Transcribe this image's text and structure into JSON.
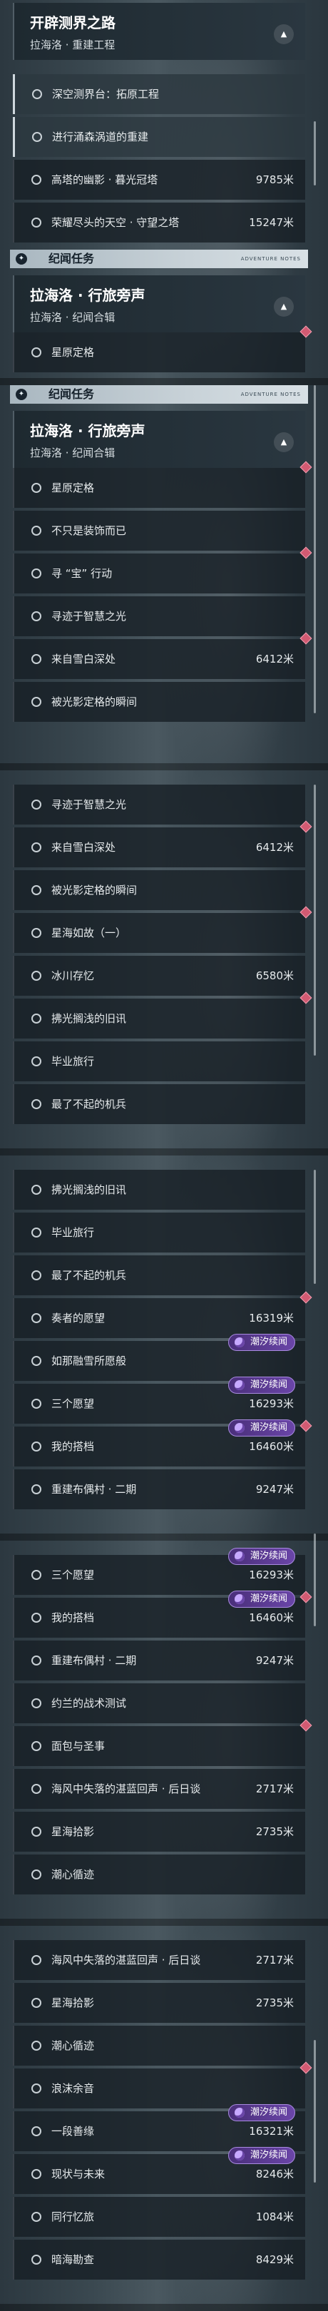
{
  "badge_label": "潮汐续闻",
  "sections": [
    {
      "items": [
        {
          "kind": "header",
          "title": "开辟测界之路",
          "subtitle": "拉海洛 · 重建工程",
          "chevron": "▲"
        },
        {
          "kind": "row",
          "name": "深空测界台：拓原工程",
          "hl": true
        },
        {
          "kind": "row",
          "name": "进行涌森涡道的重建",
          "hl": true
        },
        {
          "kind": "row",
          "name": "高塔的幽影 · 暮光冠塔",
          "dist": "9785米"
        },
        {
          "kind": "row",
          "name": "荣耀尽头的天空 · 守望之塔",
          "dist": "15247米"
        },
        {
          "kind": "cat",
          "title": "纪闻任务",
          "small": "ADVENTURE NOTES",
          "icon": "✦"
        },
        {
          "kind": "header",
          "title": "拉海洛 · 行旅旁声",
          "subtitle": "拉海洛 · 纪闻合辑",
          "chevron": "▲"
        },
        {
          "kind": "row",
          "name": "星原定格",
          "dia": true
        }
      ]
    },
    {
      "items": [
        {
          "kind": "cat",
          "title": "纪闻任务",
          "small": "ADVENTURE NOTES",
          "icon": "✦"
        },
        {
          "kind": "header",
          "title": "拉海洛 · 行旅旁声",
          "subtitle": "拉海洛 · 纪闻合辑",
          "chevron": "▲"
        },
        {
          "kind": "row",
          "name": "星原定格",
          "dia": true
        },
        {
          "kind": "row",
          "name": "不只是装饰而已"
        },
        {
          "kind": "row",
          "name": "寻 “宝” 行动",
          "dia": true
        },
        {
          "kind": "row",
          "name": "寻迹于智慧之光"
        },
        {
          "kind": "row",
          "name": "来自雪白深处",
          "dist": "6412米",
          "dia": true
        },
        {
          "kind": "row",
          "name": "被光影定格的瞬间"
        }
      ]
    },
    {
      "items": [
        {
          "kind": "row",
          "name": "寻迹于智慧之光"
        },
        {
          "kind": "row",
          "name": "来自雪白深处",
          "dist": "6412米",
          "dia": true
        },
        {
          "kind": "row",
          "name": "被光影定格的瞬间"
        },
        {
          "kind": "row",
          "name": "星海如故（一）",
          "dia": true
        },
        {
          "kind": "row",
          "name": "冰川存忆",
          "dist": "6580米"
        },
        {
          "kind": "row",
          "name": "拂光搁浅的旧讯",
          "dia": true
        },
        {
          "kind": "row",
          "name": "毕业旅行"
        },
        {
          "kind": "row",
          "name": "最了不起的机兵"
        }
      ]
    },
    {
      "items": [
        {
          "kind": "row",
          "name": "拂光搁浅的旧讯"
        },
        {
          "kind": "row",
          "name": "毕业旅行"
        },
        {
          "kind": "row",
          "name": "最了不起的机兵"
        },
        {
          "kind": "row",
          "name": "奏者的愿望",
          "dist": "16319米",
          "dia": true
        },
        {
          "kind": "row",
          "name": "如那融雪所愿般",
          "badge": true
        },
        {
          "kind": "row",
          "name": "三个愿望",
          "dist": "16293米",
          "badge": true
        },
        {
          "kind": "row",
          "name": "我的搭档",
          "dist": "16460米",
          "badge": true,
          "dia": true
        },
        {
          "kind": "row",
          "name": "重建布偶村 · 二期",
          "dist": "9247米"
        }
      ]
    },
    {
      "items": [
        {
          "kind": "row",
          "name": "三个愿望",
          "dist": "16293米",
          "badge": true
        },
        {
          "kind": "row",
          "name": "我的搭档",
          "dist": "16460米",
          "badge": true,
          "dia": true
        },
        {
          "kind": "row",
          "name": "重建布偶村 · 二期",
          "dist": "9247米"
        },
        {
          "kind": "row",
          "name": "约兰的战术测试"
        },
        {
          "kind": "row",
          "name": "面包与圣事",
          "dia": true
        },
        {
          "kind": "row",
          "name": "海风中失落的湛蓝回声 · 后日谈",
          "dist": "2717米"
        },
        {
          "kind": "row",
          "name": "星海拾影",
          "dist": "2735米"
        },
        {
          "kind": "row",
          "name": "潮心循迹"
        }
      ]
    },
    {
      "items": [
        {
          "kind": "row",
          "name": "海风中失落的湛蓝回声 · 后日谈",
          "dist": "2717米"
        },
        {
          "kind": "row",
          "name": "星海拾影",
          "dist": "2735米"
        },
        {
          "kind": "row",
          "name": "潮心循迹"
        },
        {
          "kind": "row",
          "name": "浪沫余音",
          "dia": true
        },
        {
          "kind": "row",
          "name": "一段善缘",
          "dist": "16321米",
          "badge": true
        },
        {
          "kind": "row",
          "name": "现状与未来",
          "dist": "8246米",
          "badge": true
        },
        {
          "kind": "row",
          "name": "同行忆旅",
          "dist": "1084米"
        },
        {
          "kind": "row",
          "name": "暗海勘查",
          "dist": "8429米"
        }
      ]
    }
  ]
}
